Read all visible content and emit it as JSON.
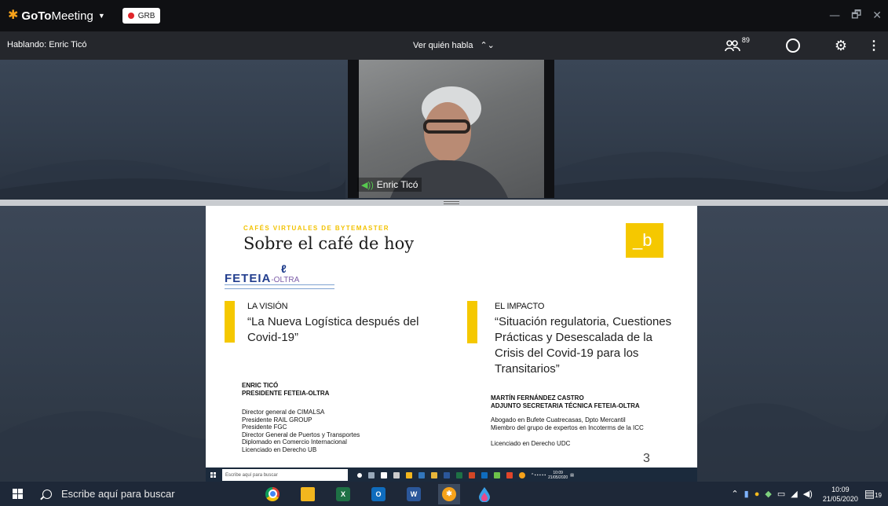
{
  "window": {
    "app_name_bold": "GoTo",
    "app_name_light": "Meeting",
    "recording_label": "GRB",
    "controls": [
      "—",
      "🗗",
      "✕"
    ]
  },
  "toolbar": {
    "speaking_text": "Hablando: Enric Ticó",
    "view_select_label": "Ver quién habla",
    "attendee_count": "89"
  },
  "video": {
    "speaker_name": "Enric Ticó"
  },
  "slide": {
    "kicker": "CAFÉS VIRTUALES DE BYTEMASTER",
    "title": "Sobre el café de hoy",
    "brand_mark": "_b",
    "org_logo_text": "FETEIA",
    "org_logo_suffix": "-OLTRA",
    "left": {
      "heading": "LA VISIÓN",
      "quote": "“La Nueva Logística después del Covid-19”",
      "person_name": "ENRIC TICÓ",
      "person_role": "PRESIDENTE FETEIA-OLTRA",
      "bio": [
        "Director general de CIMALSA",
        "Presidente RAIL GROUP",
        "Presidente FGC",
        "Director General de Puertos y Transportes",
        "Diplomado en Comercio Internacional",
        "Licenciado en Derecho UB"
      ]
    },
    "right": {
      "heading": "EL IMPACTO",
      "quote": "“Situación regulatoria, Cuestiones Prácticas y Desescalada de la Crisis del Covid-19 para los Transitarios”",
      "person_name": "MARTÍN FERNÁNDEZ CASTRO",
      "person_role": "ADJUNTO SECRETARIA TÉCNICA FETEIA-OLTRA",
      "bio": [
        "Abogado en Bufete Cuatrecasas, Dpto Mercantil",
        "Miembro del grupo de expertos en Incoterms de la ICC"
      ],
      "bio_extra": "Licenciado en Derecho UDC"
    },
    "page_number": "3",
    "inner_search_placeholder": "Escribe aquí para buscar",
    "inner_clock_time": "10:09",
    "inner_clock_date": "21/05/2020"
  },
  "taskbar": {
    "search_placeholder": "Escribe aquí para buscar",
    "clock_time": "10:09",
    "clock_date": "21/05/2020",
    "notification_count": "19",
    "apps": [
      {
        "name": "chrome-app",
        "letter": "",
        "color": "#4285f4"
      },
      {
        "name": "file-explorer-app",
        "letter": "",
        "color": "#f2b61e"
      },
      {
        "name": "excel-app",
        "letter": "X",
        "color": "#1e7145"
      },
      {
        "name": "outlook-app",
        "letter": "O",
        "color": "#0f6cbd"
      },
      {
        "name": "word-app",
        "letter": "W",
        "color": "#2b579a"
      },
      {
        "name": "gotomeeting-app",
        "letter": "✱",
        "color": "#f6a21a"
      },
      {
        "name": "drop-app",
        "letter": "",
        "color": "#3aa0e8"
      }
    ]
  },
  "colors": {
    "accent_yellow": "#f5c800",
    "goto_orange": "#f6a21a",
    "record_red": "#e0252a"
  }
}
